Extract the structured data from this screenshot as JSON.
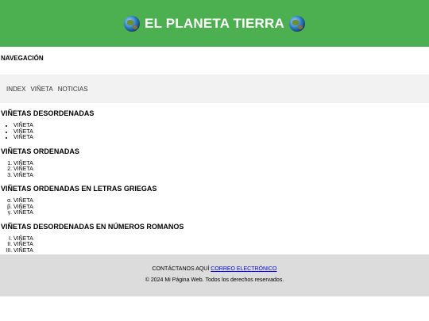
{
  "header": {
    "title": "EL PLANETA TIERRA",
    "left_icon": "globe-icon",
    "right_icon": "globe-icon"
  },
  "nav": {
    "heading": "NAVEGACIÓN",
    "links": [
      "INDEX",
      "VIÑETA",
      "NOTICIAS"
    ]
  },
  "sections": [
    {
      "title": "VIÑETAS DESORDENADAS",
      "style": "disc",
      "items": [
        "VIÑETA",
        "VIÑETA",
        "VIÑETA"
      ]
    },
    {
      "title": "VIÑETAS ORDENADAS",
      "style": "decimal",
      "items": [
        "VIÑETA",
        "VIÑETA",
        "VIÑETA"
      ]
    },
    {
      "title": "VIÑETAS ORDENADAS EN LETRAS GRIEGAS",
      "style": "lower-greek",
      "items": [
        "VIÑETA",
        "VIÑETA",
        "VIÑETA"
      ]
    },
    {
      "title": "VIÑETAS DESORDENADAS EN NÚMEROS ROMANOS",
      "style": "upper-roman",
      "items": [
        "VIÑETA",
        "VIÑETA",
        "VIÑETA"
      ]
    }
  ],
  "footer": {
    "contact_prefix": "CONTÁCTANOS AQUÍ",
    "contact_link": "CORREO ELECTRÓNICO",
    "copyright": "© 2024 Mi Página Web. Todos los derechos reservados."
  },
  "colors": {
    "header_bg": "#4caf50",
    "nav_bg": "#f2f2f2",
    "footer_bg": "#dcdcdc",
    "link": "#0000ee"
  }
}
